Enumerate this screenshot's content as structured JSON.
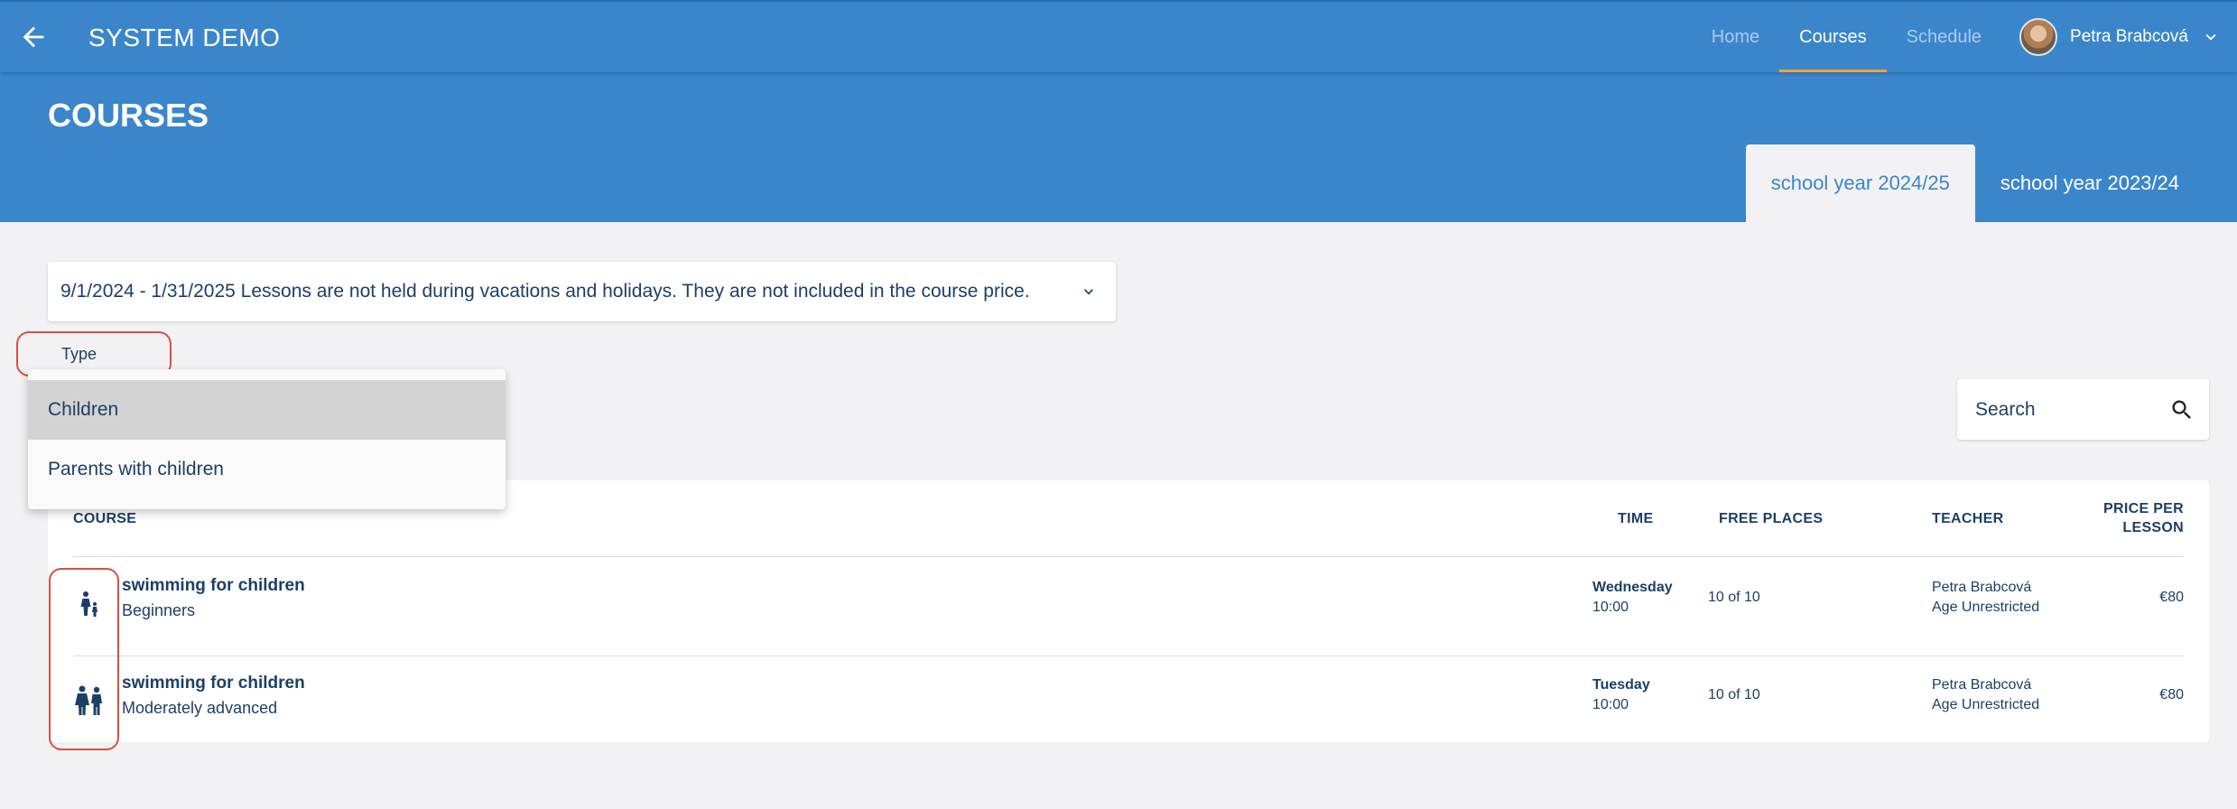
{
  "appbar": {
    "title": "SYSTEM DEMO",
    "back_icon": "arrow-left-icon",
    "nav": [
      {
        "label": "Home",
        "active": false
      },
      {
        "label": "Courses",
        "active": true
      },
      {
        "label": "Schedule",
        "active": false
      }
    ],
    "user_name": "Petra Brabcová",
    "user_menu_icon": "chevron-down-icon"
  },
  "page": {
    "title": "COURSES",
    "tabs": [
      {
        "label": "school year 2024/25",
        "active": true
      },
      {
        "label": "school year 2023/24",
        "active": false
      }
    ]
  },
  "info_select": {
    "text": "9/1/2024 - 1/31/2025 Lessons are not held during vacations and holidays. They are not included in the course price."
  },
  "type_filter": {
    "label": "Type",
    "options": [
      {
        "label": "Children",
        "selected": true
      },
      {
        "label": "Parents with children",
        "selected": false
      }
    ]
  },
  "search": {
    "placeholder": "Search",
    "icon": "search-icon"
  },
  "table": {
    "headers": {
      "course": "COURSE",
      "time": "TIME",
      "free_places": "FREE PLACES",
      "teacher": "TEACHER",
      "price_line1": "PRICE PER",
      "price_line2": "LESSON"
    },
    "rows": [
      {
        "icon": "parent-with-child-icon",
        "name": "swimming for children",
        "level": "Beginners",
        "day": "Wednesday",
        "time": "10:00",
        "free_places": "10 of 10",
        "teacher": "Petra Brabcová",
        "age": "Age Unrestricted",
        "price": "€80"
      },
      {
        "icon": "children-icon",
        "name": "swimming for children",
        "level": "Moderately advanced",
        "day": "Tuesday",
        "time": "10:00",
        "free_places": "10 of 10",
        "teacher": "Petra Brabcová",
        "age": "Age Unrestricted",
        "price": "€80"
      }
    ]
  },
  "colors": {
    "primary": "#3b86cb",
    "accent": "#f0a33a",
    "text": "#1d3f66",
    "highlight": "#d9503f"
  }
}
